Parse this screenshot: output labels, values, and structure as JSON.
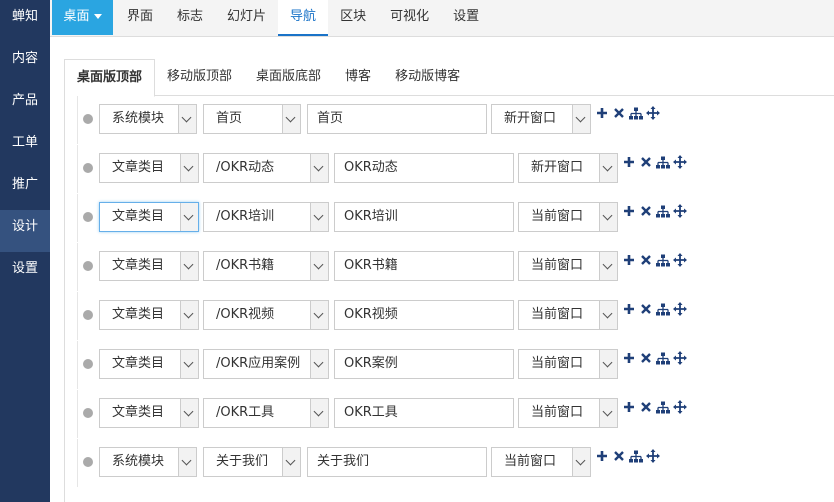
{
  "sidebar": {
    "items": [
      {
        "label": "蝉知",
        "active": false
      },
      {
        "label": "内容",
        "active": false
      },
      {
        "label": "产品",
        "active": false
      },
      {
        "label": "工单",
        "active": false
      },
      {
        "label": "推广",
        "active": false
      },
      {
        "label": "设计",
        "active": true
      },
      {
        "label": "设置",
        "active": false
      }
    ]
  },
  "topbar": {
    "desk_label": "桌面",
    "nav": [
      {
        "label": "界面",
        "active": false
      },
      {
        "label": "标志",
        "active": false
      },
      {
        "label": "幻灯片",
        "active": false
      },
      {
        "label": "导航",
        "active": true
      },
      {
        "label": "区块",
        "active": false
      },
      {
        "label": "可视化",
        "active": false
      },
      {
        "label": "设置",
        "active": false
      }
    ]
  },
  "tabs": [
    {
      "label": "桌面版顶部",
      "active": true
    },
    {
      "label": "移动版顶部",
      "active": false
    },
    {
      "label": "桌面版底部",
      "active": false
    },
    {
      "label": "博客",
      "active": false
    },
    {
      "label": "移动版博客",
      "active": false
    }
  ],
  "colors": {
    "sidebar_bg": "#22385f",
    "accent": "#2aa5e1",
    "active_link": "#1a73c8",
    "icon": "#1f3f78"
  },
  "icons": [
    "plus-icon",
    "remove-icon",
    "sitemap-icon",
    "move-icon"
  ],
  "rows": [
    {
      "type": "系统模块",
      "target": "首页",
      "title": "首页",
      "window": "新开窗口"
    },
    {
      "type": "文章类目",
      "target": "/OKR动态",
      "title": "OKR动态",
      "window": "新开窗口"
    },
    {
      "type": "文章类目",
      "target": "/OKR培训",
      "title": "OKR培训",
      "window": "当前窗口"
    },
    {
      "type": "文章类目",
      "target": "/OKR书籍",
      "title": "OKR书籍",
      "window": "当前窗口"
    },
    {
      "type": "文章类目",
      "target": "/OKR视频",
      "title": "OKR视频",
      "window": "当前窗口"
    },
    {
      "type": "文章类目",
      "target": "/OKR应用案例",
      "title": "OKR案例",
      "window": "当前窗口"
    },
    {
      "type": "文章类目",
      "target": "/OKR工具",
      "title": "OKR工具",
      "window": "当前窗口"
    },
    {
      "type": "系统模块",
      "target": "关于我们",
      "title": "关于我们",
      "window": "当前窗口"
    }
  ]
}
